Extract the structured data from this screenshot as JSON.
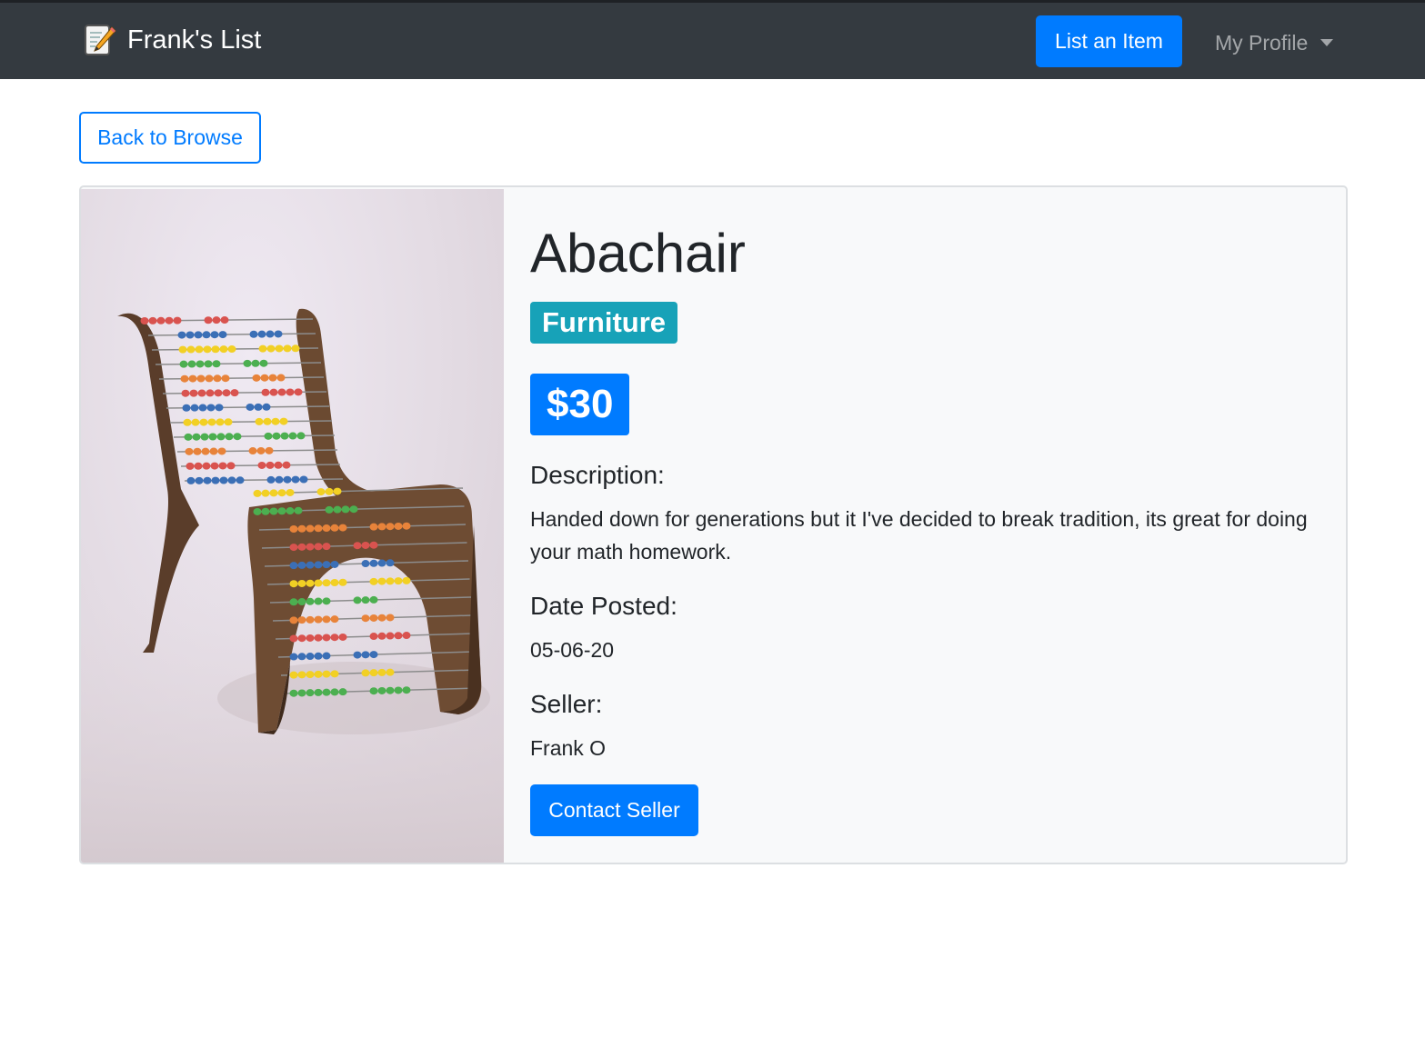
{
  "navbar": {
    "brand_icon": "memo-pencil-icon",
    "brand_name": "Frank's List",
    "list_item_label": "List an Item",
    "profile_label": "My Profile",
    "colors": {
      "background": "#343a40",
      "primary": "#007bff"
    }
  },
  "back_button": {
    "label": "Back to Browse"
  },
  "listing": {
    "image_alt": "Abacus chair",
    "title": "Abachair",
    "category": "Furniture",
    "price": "$30",
    "description_label": "Description:",
    "description": "Handed down for generations but it I've decided to break tradition, its great for doing your math homework.",
    "date_label": "Date Posted:",
    "date": "05-06-20",
    "seller_label": "Seller:",
    "seller": "Frank O",
    "contact_label": "Contact Seller",
    "colors": {
      "category_badge": "#17a2b8",
      "price_badge": "#007bff",
      "card_background": "#f8f9fa"
    }
  }
}
